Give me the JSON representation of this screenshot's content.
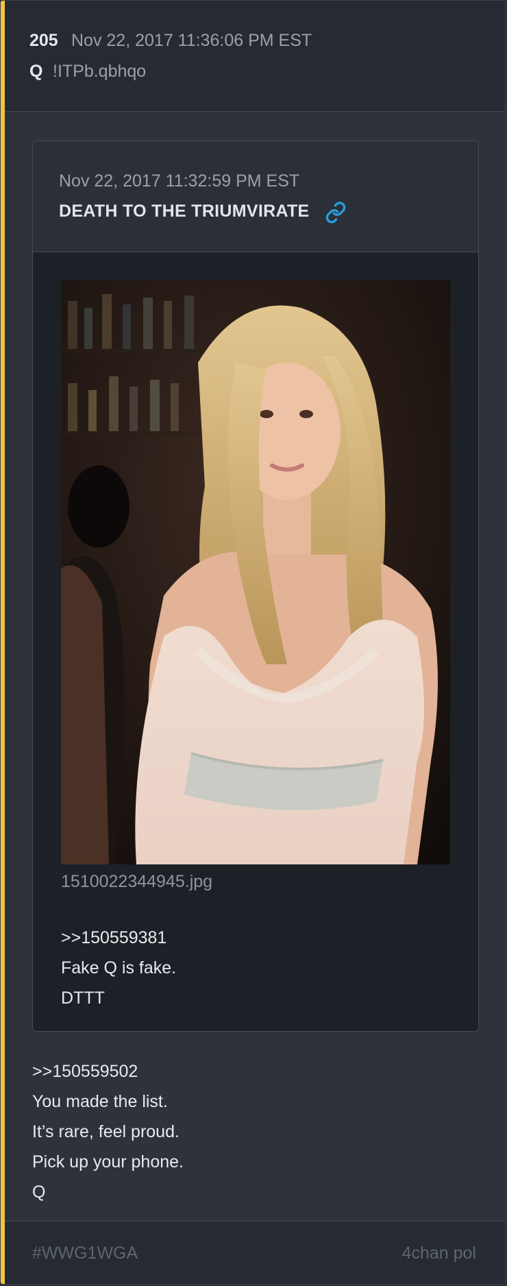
{
  "post": {
    "number": "205",
    "timestamp": "Nov 22, 2017 11:36:06 PM EST",
    "author": "Q",
    "tripcode": "!ITPb.qbhqo",
    "body_lines": [
      ">>150559502",
      "You made the list.",
      "It’s rare, feel proud.",
      "Pick up your phone.",
      "Q"
    ]
  },
  "quoted": {
    "timestamp": "Nov 22, 2017 11:32:59 PM EST",
    "title": "DEATH TO THE TRIUMVIRATE",
    "link_icon": "link-icon",
    "image_filename": "1510022344945.jpg",
    "body_lines": [
      ">>150559381",
      "Fake Q is fake.",
      "DTTT"
    ]
  },
  "footer": {
    "tag": "#WWG1WGA",
    "source": "4chan pol"
  },
  "colors": {
    "accent": "#f2c43d",
    "link": "#2a9ad8"
  }
}
